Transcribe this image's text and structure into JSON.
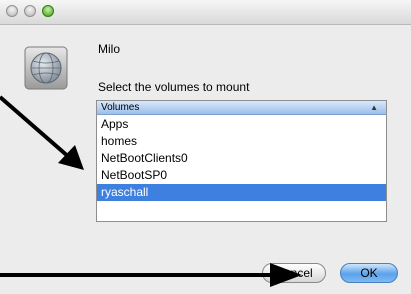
{
  "window": {
    "controls": [
      "close",
      "minimize",
      "zoom"
    ]
  },
  "dialog": {
    "server_icon": "server-globe-icon",
    "server_name": "Milo",
    "prompt": "Select the volumes to mount",
    "list": {
      "header": "Volumes",
      "sort_indicator": "▲",
      "items": [
        "Apps",
        "homes",
        "NetBootClients0",
        "NetBootSP0",
        "ryaschall"
      ],
      "selected_index": 4
    },
    "buttons": {
      "cancel": "Cancel",
      "ok": "OK"
    }
  },
  "annotations": {
    "arrow_color": "#000000",
    "arrows": [
      "arrow-to-volume-list",
      "arrow-to-cancel-button"
    ]
  },
  "colors": {
    "selection": "#3d80df",
    "ok_button": "#5aa2ea",
    "zoom_button": "#3f9a17"
  }
}
